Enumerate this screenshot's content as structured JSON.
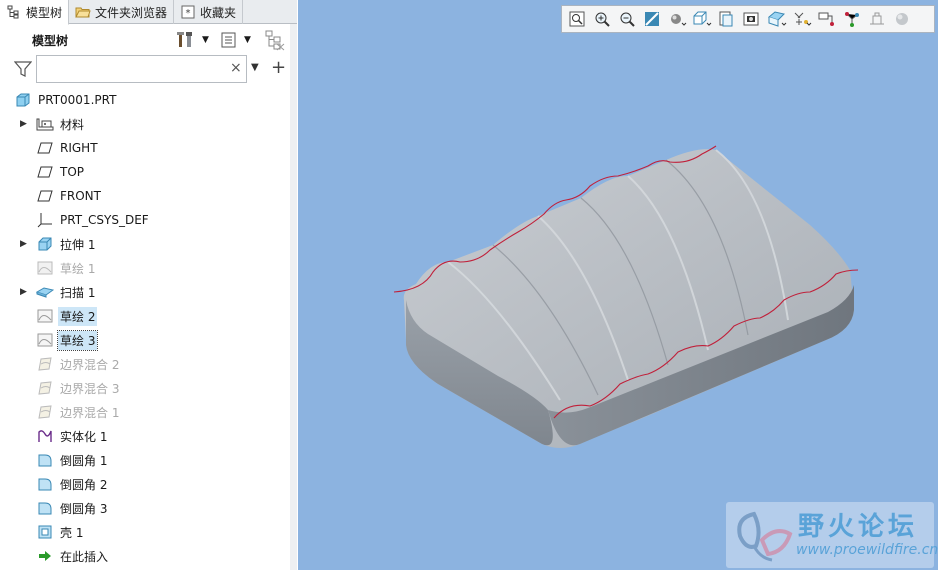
{
  "tabs": [
    {
      "label": "模型树",
      "icon": "model-tree-icon"
    },
    {
      "label": "文件夹浏览器",
      "icon": "folder-icon"
    },
    {
      "label": "收藏夹",
      "icon": "favorites-icon"
    }
  ],
  "tree_header": {
    "title": "模型树"
  },
  "filter": {
    "placeholder": "",
    "clear": "×",
    "add": "+"
  },
  "tree": {
    "root": {
      "label": "PRT0001.PRT"
    },
    "items": [
      {
        "label": "材料",
        "expandable": true
      },
      {
        "label": "RIGHT",
        "expandable": false
      },
      {
        "label": "TOP",
        "expandable": false
      },
      {
        "label": "FRONT",
        "expandable": false
      },
      {
        "label": "PRT_CSYS_DEF",
        "expandable": false
      },
      {
        "label": "拉伸 1",
        "expandable": true
      },
      {
        "label": "草绘 1",
        "expandable": false,
        "state": "dim"
      },
      {
        "label": "扫描 1",
        "expandable": true
      },
      {
        "label": "草绘 2",
        "expandable": false,
        "state": "selected"
      },
      {
        "label": "草绘 3",
        "expandable": false,
        "state": "selected-focus"
      },
      {
        "label": "边界混合 2",
        "expandable": false,
        "state": "dim"
      },
      {
        "label": "边界混合 3",
        "expandable": false,
        "state": "dim"
      },
      {
        "label": "边界混合 1",
        "expandable": false,
        "state": "dim"
      },
      {
        "label": "实体化 1",
        "expandable": false
      },
      {
        "label": "倒圆角 1",
        "expandable": false
      },
      {
        "label": "倒圆角 2",
        "expandable": false
      },
      {
        "label": "倒圆角 3",
        "expandable": false
      },
      {
        "label": "壳 1",
        "expandable": false
      },
      {
        "label": "在此插入",
        "expandable": false
      }
    ]
  },
  "watermark": {
    "title": "野火论坛",
    "url": "www.proewildfire.cn"
  },
  "colors": {
    "viewport_bg": "#8cb3e0",
    "selection": "#cde6f7",
    "curve": "#c0203a",
    "model": "#b6bcc4"
  }
}
